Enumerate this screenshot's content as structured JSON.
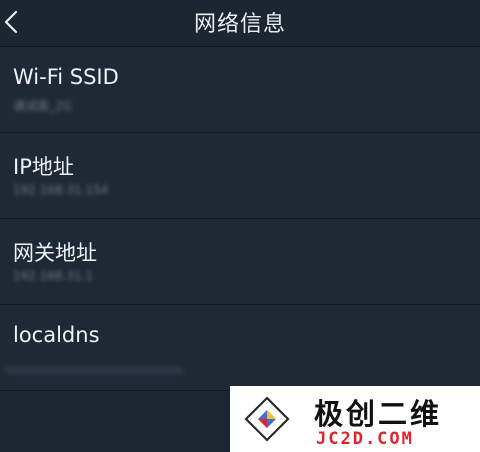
{
  "header": {
    "back_icon": "chevron-left-icon",
    "title": "网络信息"
  },
  "rows": [
    {
      "label": "Wi-Fi SSID",
      "value": "请试座_2G"
    },
    {
      "label": "IP地址",
      "value": "192.168.31.154"
    },
    {
      "label": "网关地址",
      "value": "192.168.31.1"
    },
    {
      "label": "localdns",
      "value": ""
    }
  ],
  "watermark": {
    "name": "极创二维",
    "domain": "JC2D.COM"
  },
  "colors": {
    "background": "#1c2733",
    "text": "#eef2f6",
    "watermark_red": "#e0252f"
  }
}
